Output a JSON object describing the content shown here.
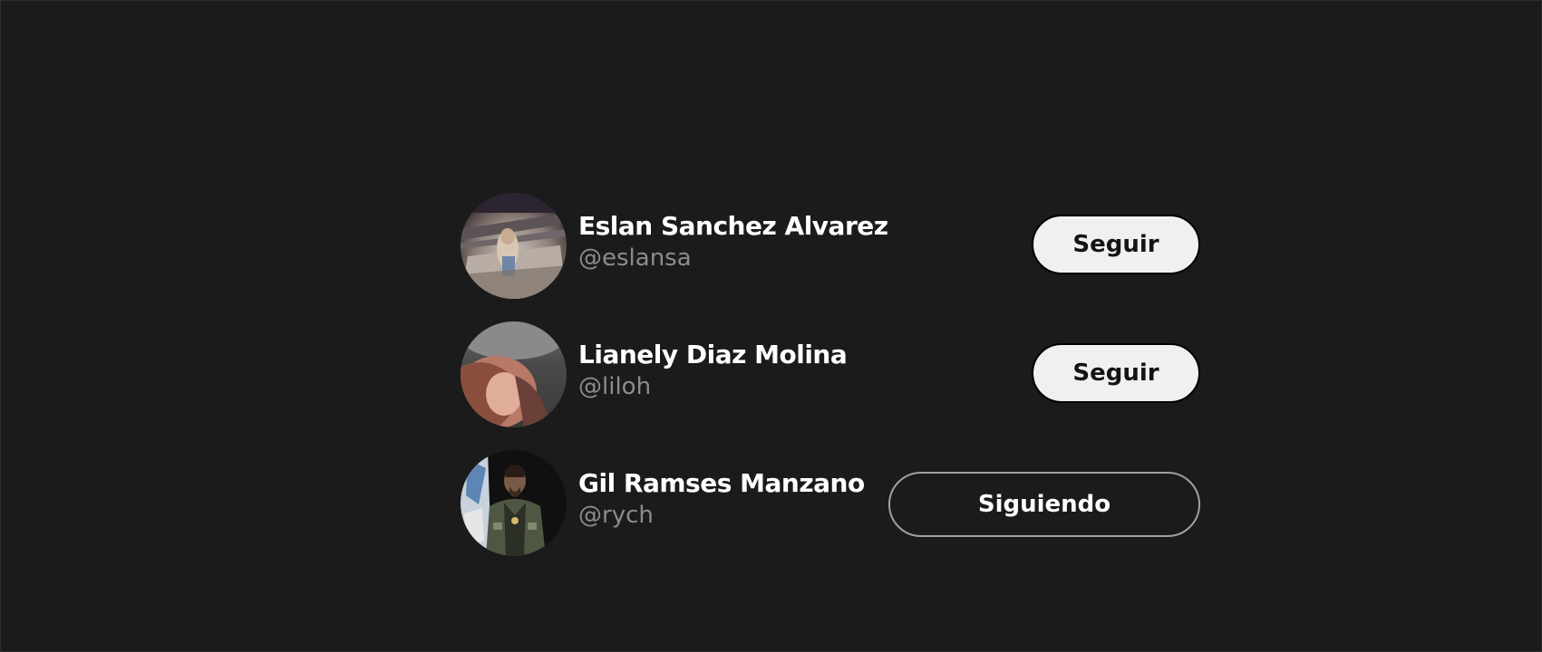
{
  "users": [
    {
      "name": "Eslan Sanchez Alvarez",
      "handle": "@eslansa",
      "button_label": "Seguir",
      "following": false
    },
    {
      "name": "Lianely Diaz Molina",
      "handle": "@liloh",
      "button_label": "Seguir",
      "following": false
    },
    {
      "name": "Gil Ramses Manzano",
      "handle": "@rych",
      "button_label": "Siguiendo",
      "following": true
    }
  ],
  "colors": {
    "background": "#1b1b1b",
    "name_text": "#ffffff",
    "handle_text": "#8c8c8c",
    "follow_button_bg": "#f0f0f0",
    "following_button_border": "#a0a0a0"
  }
}
